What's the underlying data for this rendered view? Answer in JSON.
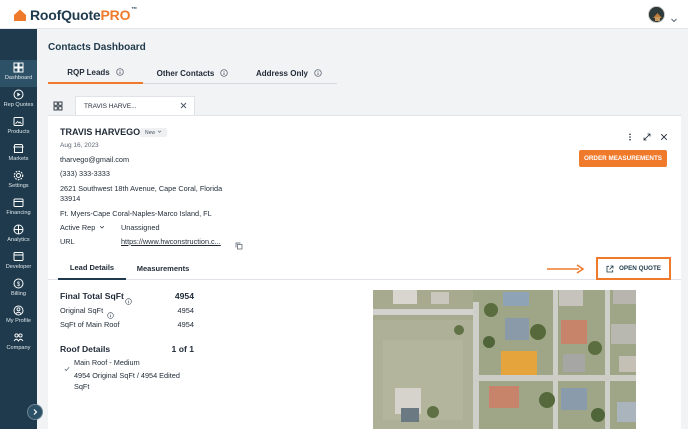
{
  "brand": {
    "name": "RoofQuote",
    "suffix": "PRO",
    "tm": "™",
    "accent": "#f07a2b",
    "navy": "#1e3a4c"
  },
  "sidebar": {
    "items": [
      {
        "label": "Dashboard",
        "icon": "dashboard-icon",
        "active": true
      },
      {
        "label": "Rep Quotes",
        "icon": "play-circle-icon"
      },
      {
        "label": "Products",
        "icon": "products-icon"
      },
      {
        "label": "Markets",
        "icon": "store-icon"
      },
      {
        "label": "Settings",
        "icon": "gear-icon"
      },
      {
        "label": "Financing",
        "icon": "wallet-icon"
      },
      {
        "label": "Analytics",
        "icon": "analytics-icon"
      },
      {
        "label": "Developer",
        "icon": "code-icon"
      },
      {
        "label": "Billing",
        "icon": "billing-icon"
      },
      {
        "label": "My Profile",
        "icon": "profile-icon"
      },
      {
        "label": "Company",
        "icon": "company-icon"
      }
    ]
  },
  "page": {
    "title": "Contacts Dashboard"
  },
  "tabs": [
    {
      "label": "RQP Leads",
      "active": true
    },
    {
      "label": "Other Contacts"
    },
    {
      "label": "Address Only"
    }
  ],
  "doc_tab": {
    "label": "TRAVIS HARVE..."
  },
  "lead": {
    "name": "TRAVIS HARVEGO",
    "status": "New",
    "date": "Aug 16, 2023",
    "email": "tharvego@gmail.com",
    "phone": "(333) 333-3333",
    "address_line1": "2621 Southwest 18th Avenue, Cape Coral, Florida",
    "address_line2": "33914",
    "market": "Ft. Myers-Cape Coral-Naples-Marco Island, FL",
    "rep_label": "Active Rep",
    "rep_value": "Unassigned",
    "url_label": "URL",
    "url_value": "https://www.hwconstruction.c..."
  },
  "actions": {
    "order_measurements": "ORDER MEASUREMENTS",
    "open_quote": "OPEN QUOTE"
  },
  "sub_tabs": [
    {
      "label": "Lead Details",
      "active": true
    },
    {
      "label": "Measurements"
    }
  ],
  "metrics": {
    "final_label": "Final Total SqFt",
    "final_value": "4954",
    "original_label": "Original SqFt",
    "original_value": "4954",
    "main_label": "SqFt of Main Roof",
    "main_value": "4954"
  },
  "roof": {
    "label": "Roof Details",
    "count": "1 of 1",
    "item_title": "Main Roof - Medium",
    "item_desc_1": "4954 Original SqFt / 4954 Edited",
    "item_desc_2": "SqFt"
  }
}
